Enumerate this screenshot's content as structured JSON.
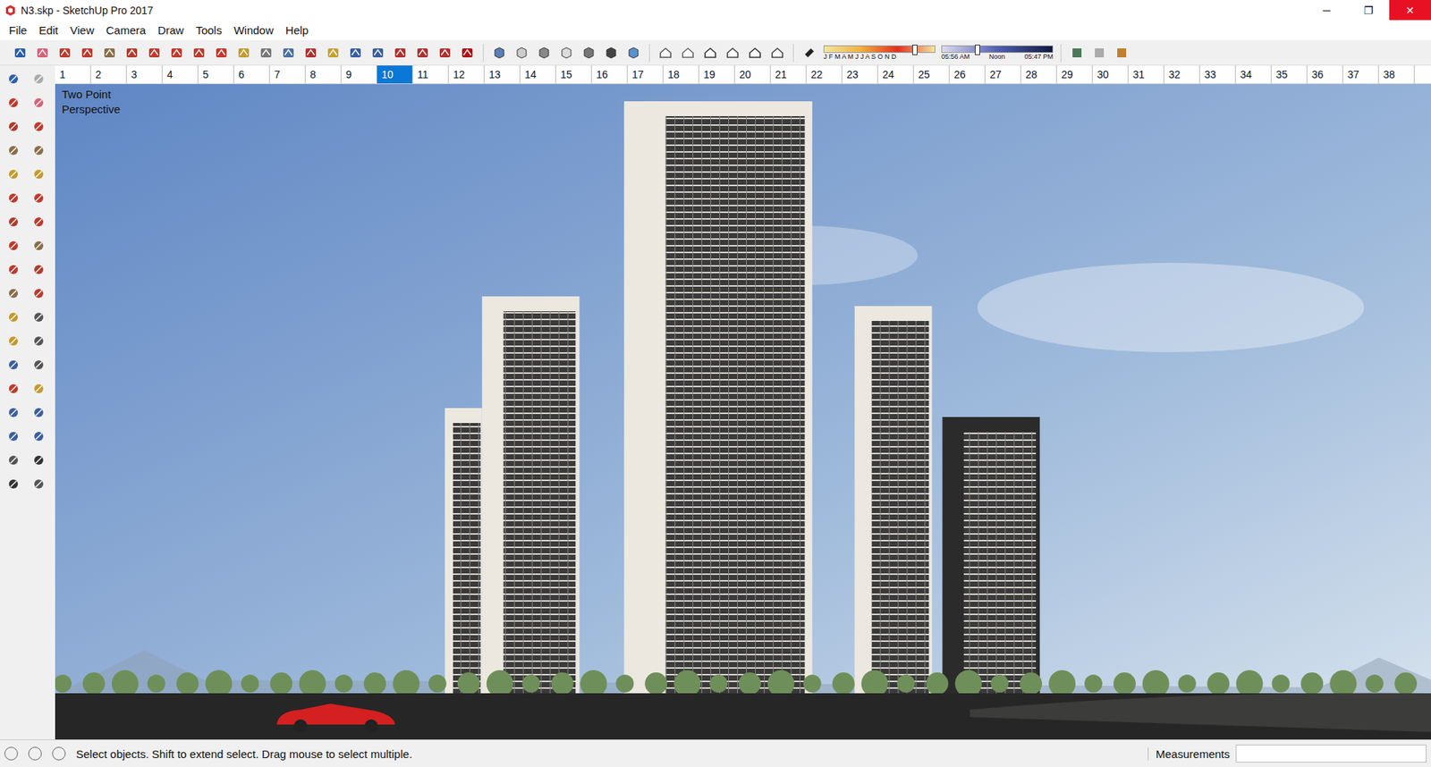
{
  "window": {
    "title": "N3.skp - SketchUp Pro 2017",
    "controls": [
      "─",
      "❐",
      "✕"
    ]
  },
  "menu": [
    "File",
    "Edit",
    "View",
    "Camera",
    "Draw",
    "Tools",
    "Window",
    "Help"
  ],
  "shadow_toolbar": {
    "months": "J F M A M J J A S O N D",
    "date_level": 0.8,
    "times": [
      "05:56 AM",
      "Noon",
      "05:47 PM"
    ],
    "time_level": 0.3
  },
  "scene_tabs": [
    {
      "label": "1",
      "selected": false
    },
    {
      "label": "2",
      "selected": false
    },
    {
      "label": "3",
      "selected": false
    },
    {
      "label": "4",
      "selected": false
    },
    {
      "label": "5",
      "selected": false
    },
    {
      "label": "6",
      "selected": false
    },
    {
      "label": "7",
      "selected": false
    },
    {
      "label": "8",
      "selected": false
    },
    {
      "label": "9",
      "selected": false
    },
    {
      "label": "10",
      "selected": true
    },
    {
      "label": "11",
      "selected": false
    },
    {
      "label": "12",
      "selected": false
    },
    {
      "label": "13",
      "selected": false
    },
    {
      "label": "14",
      "selected": false
    },
    {
      "label": "15",
      "selected": false
    },
    {
      "label": "16",
      "selected": false
    },
    {
      "label": "17",
      "selected": false
    },
    {
      "label": "18",
      "selected": false
    },
    {
      "label": "19",
      "selected": false
    },
    {
      "label": "20",
      "selected": false
    },
    {
      "label": "21",
      "selected": false
    },
    {
      "label": "22",
      "selected": false
    },
    {
      "label": "23",
      "selected": false
    },
    {
      "label": "24",
      "selected": false
    },
    {
      "label": "25",
      "selected": false
    },
    {
      "label": "26",
      "selected": false
    },
    {
      "label": "27",
      "selected": false
    },
    {
      "label": "28",
      "selected": false
    },
    {
      "label": "29",
      "selected": false
    },
    {
      "label": "30",
      "selected": false
    },
    {
      "label": "31",
      "selected": false
    },
    {
      "label": "32",
      "selected": false
    },
    {
      "label": "33",
      "selected": false
    },
    {
      "label": "34",
      "selected": false
    },
    {
      "label": "35",
      "selected": false
    },
    {
      "label": "36",
      "selected": false
    },
    {
      "label": "37",
      "selected": false
    },
    {
      "label": "38",
      "selected": false
    }
  ],
  "viewport": {
    "label": "Two Point Perspective"
  },
  "status_bar": {
    "message": "Select objects. Shift to extend select. Drag mouse to select multiple.",
    "measurements_label": "Measurements",
    "measurements_value": ""
  }
}
